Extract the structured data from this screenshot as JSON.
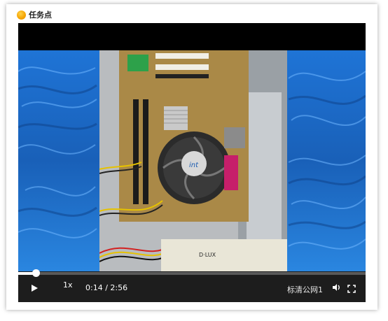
{
  "task": {
    "title": "任务点",
    "icon": "task-point-icon",
    "icon_color": "#f5a300"
  },
  "player": {
    "progress_fraction": 0.051,
    "speed_label": "1x",
    "current_time": "0:14",
    "duration": "2:56",
    "time_display": "0:14 / 2:56",
    "quality_label": "标清公网1",
    "play_icon": "play-icon",
    "volume_icon": "volume-icon",
    "fullscreen_icon": "fullscreen-icon"
  },
  "video_frame": {
    "description_label": "D·LUX"
  },
  "colors": {
    "control_bar": "#1d1d1d",
    "background_blue": "#1e6fcf"
  }
}
